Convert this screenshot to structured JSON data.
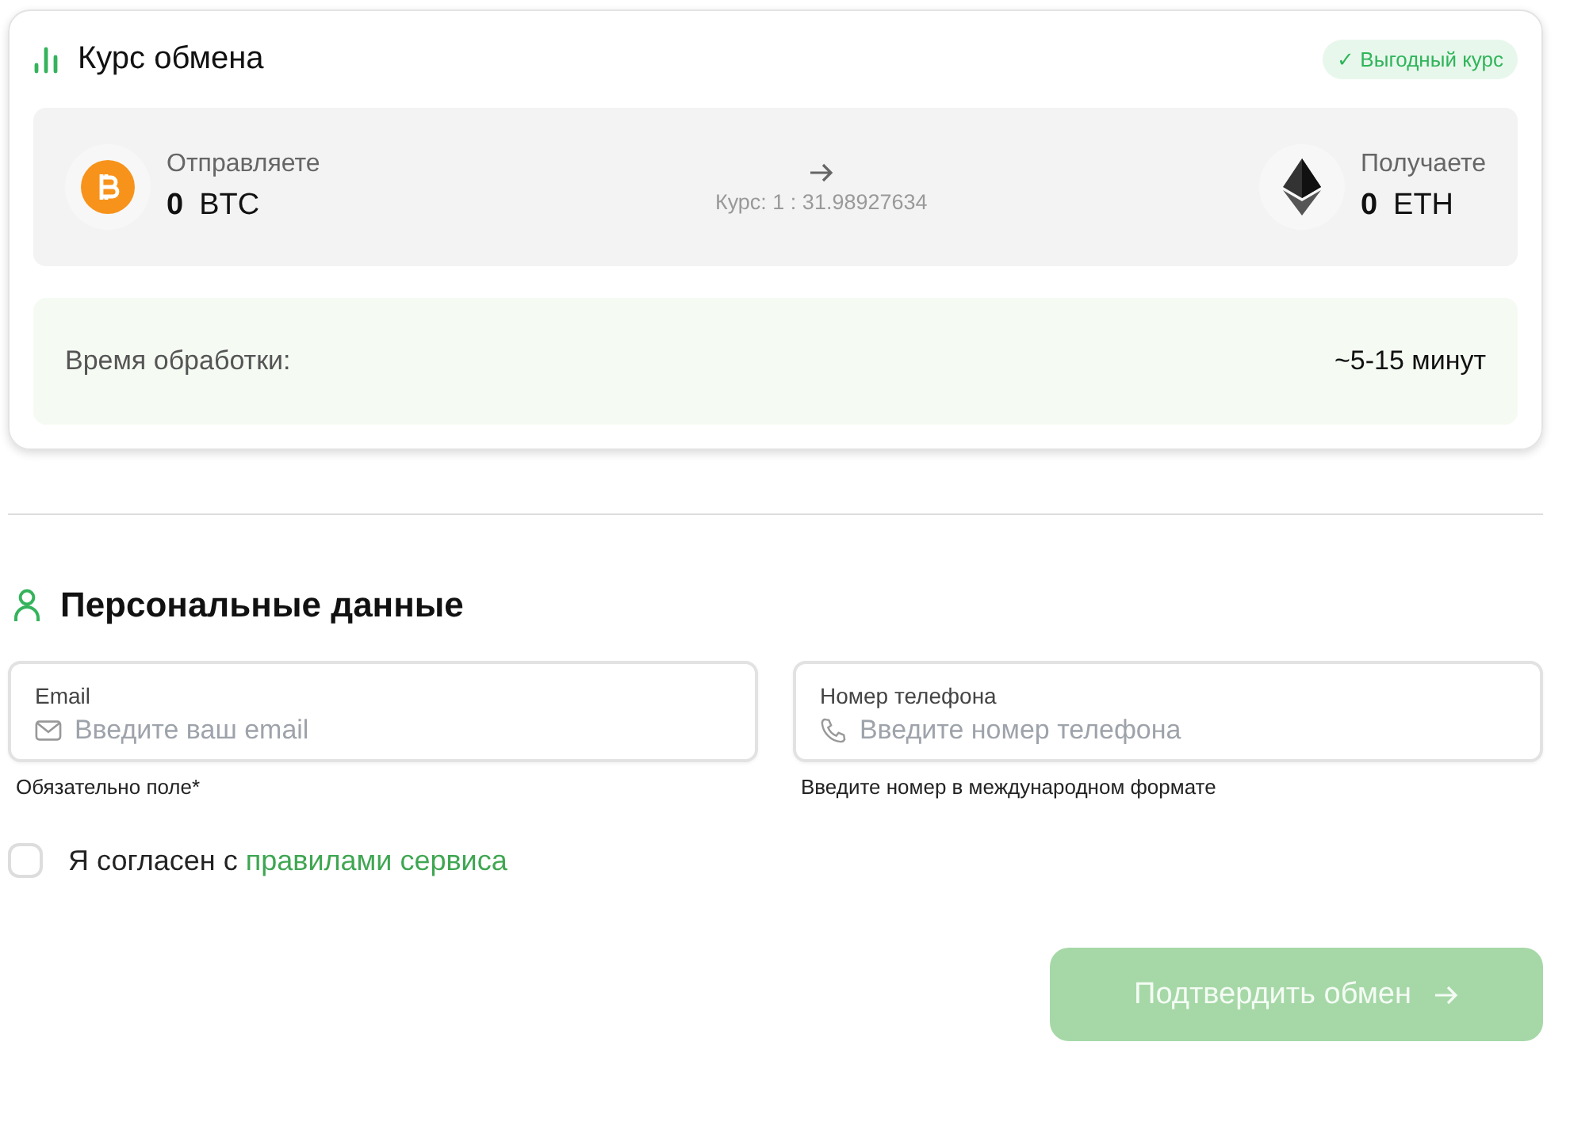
{
  "rate_card": {
    "title": "Курс обмена",
    "badge": "✓ Выгодный курс",
    "send": {
      "label": "Отправляете",
      "amount": "0",
      "currency": "BTC"
    },
    "rate": "Курс: 1 : 31.98927634",
    "receive": {
      "label": "Получаете",
      "amount": "0",
      "currency": "ETH"
    },
    "processing": {
      "label": "Время обработки:",
      "value": "~5-15 минут"
    }
  },
  "personal": {
    "title": "Персональные данные",
    "fields": [
      {
        "kind": "email",
        "label": "Email",
        "placeholder": "Введите ваш email",
        "hint": "Обязательно поле*"
      },
      {
        "kind": "phone",
        "label": "Номер телефона",
        "placeholder": "Введите номер телефона",
        "hint": "Введите номер в международном формате"
      }
    ],
    "agreement": {
      "text": "Я согласен с",
      "link": "правилами сервиса",
      "checked": false
    },
    "submit": {
      "label": "Подтвердить обмен",
      "disabled": true
    }
  }
}
